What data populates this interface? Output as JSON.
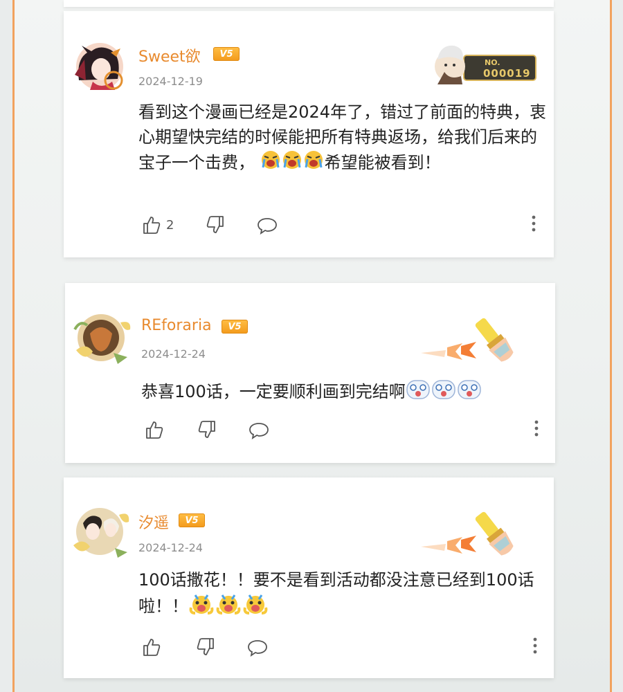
{
  "theme": {
    "accent": "#f2a25e",
    "username_color": "#e88a2e",
    "vip_color": "#f5a623"
  },
  "comments": [
    {
      "username": "Sweet欲",
      "vip_label": "V5",
      "date": "2024-12-19",
      "text": "看到这个漫画已经是2024年了，错过了前面的特典，衷心期望快完结的时候能把所有特典返场，给我们后来的宝子一个击费，",
      "emoji": "crying-face-emoji",
      "emoji_count": 3,
      "text_after_emoji": "希望能被看到！",
      "likes": "2",
      "decoration_label": "NO.",
      "decoration_number": "000019"
    },
    {
      "username": "REforaria",
      "vip_label": "V5",
      "date": "2024-12-24",
      "text": "恭喜100话，一定要顺利画到完结啊",
      "emoji": "shocked-face-emoji",
      "emoji_count": 3,
      "decoration": "paintbrush-badge-icon"
    },
    {
      "username": "汐遥",
      "vip_label": "V5",
      "date": "2024-12-24",
      "text": "100话撒花！！要不是看到活动都没注意已经到100话啦！！",
      "emoji": "screaming-duck-emoji",
      "emoji_count": 3,
      "decoration": "paintbrush-badge-icon"
    }
  ]
}
